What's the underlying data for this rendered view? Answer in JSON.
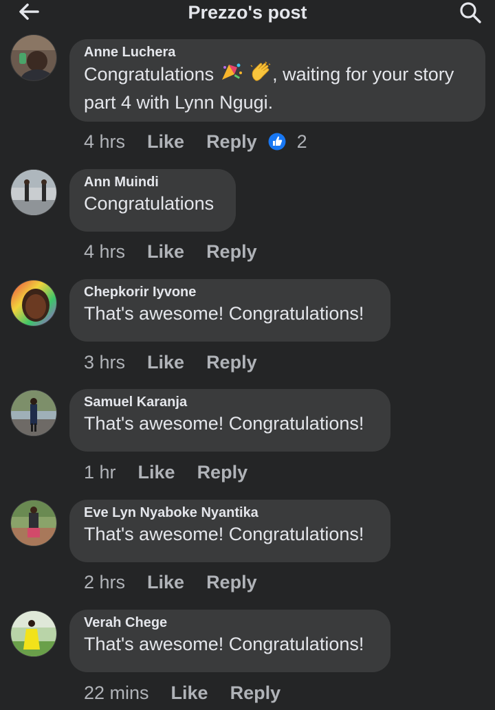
{
  "header": {
    "title": "Prezzo's post",
    "back_icon": "arrow-left-icon",
    "search_icon": "search-icon"
  },
  "colors": {
    "background": "#242526",
    "bubble": "#3a3b3c",
    "text": "#e4e6eb",
    "meta": "#b0b3b8",
    "like_badge": "#1877f2"
  },
  "comments": [
    {
      "author": "Anne Luchera",
      "text_before": "Congratulations",
      "text_after": ", waiting for your story",
      "text_line2": "part 4 with Lynn  Ngugi.",
      "emojis": [
        "confetti-ball-icon",
        "clapping-hands-icon"
      ],
      "time": "4 hrs",
      "like": "Like",
      "reply": "Reply",
      "reaction_icon": "thumbs-up-icon",
      "reaction_count": "2"
    },
    {
      "author": "Ann Muindi",
      "text": "Congratulations",
      "time": "4 hrs",
      "like": "Like",
      "reply": "Reply"
    },
    {
      "author": "Chepkorir Iyvone",
      "text": "That's awesome! Congratulations!",
      "time": "3 hrs",
      "like": "Like",
      "reply": "Reply"
    },
    {
      "author": "Samuel Karanja",
      "text": "That's awesome! Congratulations!",
      "time": "1 hr",
      "like": "Like",
      "reply": "Reply"
    },
    {
      "author": "Eve Lyn Nyaboke Nyantika",
      "text": "That's awesome! Congratulations!",
      "time": "2 hrs",
      "like": "Like",
      "reply": "Reply"
    },
    {
      "author": "Verah Chege",
      "text": "That's awesome! Congratulations!",
      "time": "22 mins",
      "like": "Like",
      "reply": "Reply"
    }
  ]
}
